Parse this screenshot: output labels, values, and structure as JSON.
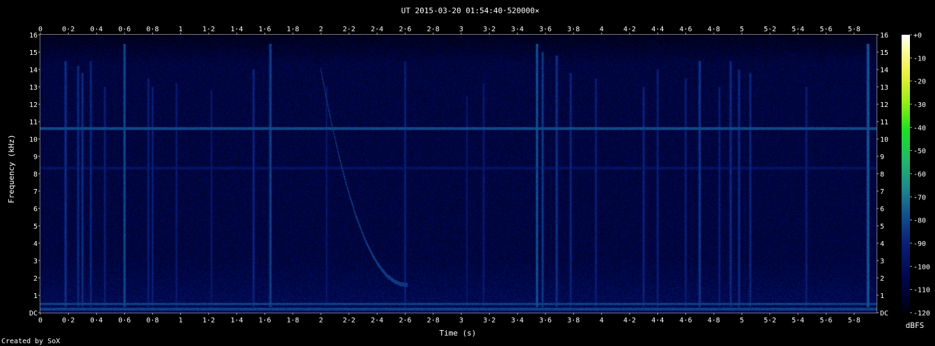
{
  "chart_data": {
    "type": "heatmap",
    "title": "UT 2015-03-20 01:54:40·520000×",
    "xlabel": "Time (s)",
    "ylabel": "Frequency (kHz)",
    "xlim": [
      0,
      5.96
    ],
    "ylim": [
      0,
      16
    ],
    "x_ticks": [
      "0",
      "0·2",
      "0·4",
      "0·6",
      "0·8",
      "1",
      "1·2",
      "1·4",
      "1·6",
      "1·8",
      "2",
      "2·2",
      "2·4",
      "2·6",
      "2·8",
      "3",
      "3·2",
      "3·4",
      "3·6",
      "3·8",
      "4",
      "4·2",
      "4·4",
      "4·6",
      "4·8",
      "5",
      "5·2",
      "5·4",
      "5·6",
      "5·8"
    ],
    "x_tick_values": [
      0,
      0.2,
      0.4,
      0.6,
      0.8,
      1,
      1.2,
      1.4,
      1.6,
      1.8,
      2,
      2.2,
      2.4,
      2.6,
      2.8,
      3,
      3.2,
      3.4,
      3.6,
      3.8,
      4,
      4.2,
      4.4,
      4.6,
      4.8,
      5,
      5.2,
      5.4,
      5.6,
      5.8
    ],
    "y_ticks": [
      "DC",
      "1",
      "2",
      "3",
      "4",
      "5",
      "6",
      "7",
      "8",
      "9",
      "10",
      "11",
      "12",
      "13",
      "14",
      "15",
      "16"
    ],
    "y_tick_values": [
      0,
      1,
      2,
      3,
      4,
      5,
      6,
      7,
      8,
      9,
      10,
      11,
      12,
      13,
      14,
      15,
      16
    ],
    "colorbar": {
      "label": "dBFS",
      "ticks": [
        "+0",
        "-10",
        "-20",
        "-30",
        "-40",
        "-50",
        "-60",
        "-70",
        "-80",
        "-90",
        "-100",
        "-110",
        "-120"
      ],
      "tick_values": [
        0,
        -10,
        -20,
        -30,
        -40,
        -50,
        -60,
        -70,
        -80,
        -90,
        -100,
        -110,
        -120
      ],
      "range": [
        -120,
        0
      ]
    },
    "features": {
      "hum_lines_khz": [
        0.2,
        0.5
      ],
      "carrier_lines": [
        {
          "freq_khz": 10.6,
          "level_dbfs": -80
        },
        {
          "freq_khz": 8.3,
          "level_dbfs": -98
        }
      ],
      "impulses": [
        {
          "t": 0.18,
          "fmax": 14.5,
          "level": -82
        },
        {
          "t": 0.27,
          "fmax": 14.2,
          "level": -85
        },
        {
          "t": 0.3,
          "fmax": 13.8,
          "level": -84
        },
        {
          "t": 0.36,
          "fmax": 14.5,
          "level": -86
        },
        {
          "t": 0.46,
          "fmax": 13.0,
          "level": -88
        },
        {
          "t": 0.6,
          "fmax": 15.5,
          "level": -76
        },
        {
          "t": 0.77,
          "fmax": 13.5,
          "level": -88
        },
        {
          "t": 0.8,
          "fmax": 13.0,
          "level": -88
        },
        {
          "t": 0.97,
          "fmax": 13.2,
          "level": -90
        },
        {
          "t": 1.22,
          "fmax": 12.8,
          "level": -91
        },
        {
          "t": 1.52,
          "fmax": 14.0,
          "level": -86
        },
        {
          "t": 1.64,
          "fmax": 15.5,
          "level": -78
        },
        {
          "t": 2.04,
          "fmax": 13.0,
          "level": -92
        },
        {
          "t": 2.6,
          "fmax": 14.5,
          "level": -88
        },
        {
          "t": 3.04,
          "fmax": 12.5,
          "level": -92
        },
        {
          "t": 3.16,
          "fmax": 13.2,
          "level": -90
        },
        {
          "t": 3.54,
          "fmax": 15.5,
          "level": -74
        },
        {
          "t": 3.58,
          "fmax": 15.0,
          "level": -80
        },
        {
          "t": 3.68,
          "fmax": 14.8,
          "level": -82
        },
        {
          "t": 3.78,
          "fmax": 13.8,
          "level": -86
        },
        {
          "t": 3.96,
          "fmax": 13.5,
          "level": -88
        },
        {
          "t": 4.3,
          "fmax": 13.0,
          "level": -86
        },
        {
          "t": 4.4,
          "fmax": 14.0,
          "level": -88
        },
        {
          "t": 4.6,
          "fmax": 13.5,
          "level": -88
        },
        {
          "t": 4.7,
          "fmax": 14.5,
          "level": -80
        },
        {
          "t": 4.84,
          "fmax": 13.0,
          "level": -88
        },
        {
          "t": 4.92,
          "fmax": 14.5,
          "level": -84
        },
        {
          "t": 4.98,
          "fmax": 14.0,
          "level": -84
        },
        {
          "t": 5.06,
          "fmax": 13.8,
          "level": -86
        },
        {
          "t": 5.46,
          "fmax": 13.0,
          "level": -88
        },
        {
          "t": 5.9,
          "fmax": 15.5,
          "level": -72
        }
      ],
      "chirp": {
        "t_start": 2.0,
        "f_start_khz": 14.0,
        "t_end": 2.62,
        "f_end_khz": 1.6,
        "level_dbfs": -84
      },
      "noise_floor_dbfs": -108
    }
  },
  "footer": {
    "text": "Created by SoX"
  }
}
